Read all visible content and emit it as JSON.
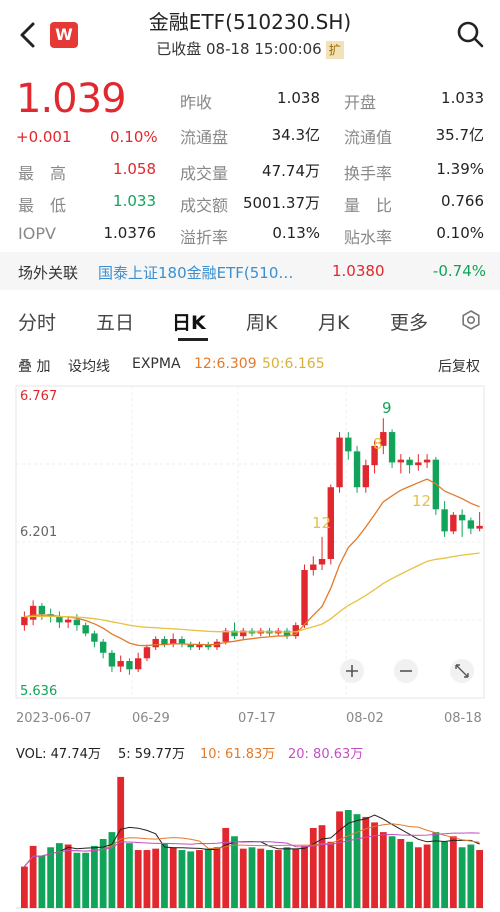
{
  "header": {
    "title": "金融ETF(510230.SH)",
    "status": "已收盘 08-18 15:00:06",
    "expand_label": "扩",
    "logo_letter": "W"
  },
  "quote": {
    "price": "1.039",
    "change": "+0.001",
    "change_pct": "0.10%",
    "left_rows": [
      {
        "label": "最　高",
        "value": "1.058",
        "color": "red"
      },
      {
        "label": "最　低",
        "value": "1.033",
        "color": "green"
      },
      {
        "label": "IOPV",
        "value": "1.0376",
        "color": "plain"
      }
    ],
    "mid_rows": [
      {
        "label": "昨收",
        "value": "1.038"
      },
      {
        "label": "流通盘",
        "value": "34.3亿"
      },
      {
        "label": "成交量",
        "value": "47.74万"
      },
      {
        "label": "成交额",
        "value": "5001.37万"
      },
      {
        "label": "溢折率",
        "value": "0.13%"
      }
    ],
    "right_rows": [
      {
        "label": "开盘",
        "value": "1.033"
      },
      {
        "label": "流通值",
        "value": "35.7亿"
      },
      {
        "label": "换手率",
        "value": "1.39%"
      },
      {
        "label": "量　比",
        "value": "0.766"
      },
      {
        "label": "贴水率",
        "value": "0.10%"
      }
    ]
  },
  "related": {
    "label": "场外关联",
    "name": "国泰上证180金融ETF(510…",
    "value": "1.0380",
    "pct": "-0.74%"
  },
  "tabs": [
    "分时",
    "五日",
    "日K",
    "周K",
    "月K",
    "更多"
  ],
  "active_tab": "日K",
  "indicators": {
    "overlay": "叠 加",
    "ma_setting": "设均线",
    "expma": "EXPMA",
    "expma12": "12:6.309",
    "expma50": "50:6.165",
    "adjust": "后复权"
  },
  "chart_data": {
    "type": "candlestick",
    "price_max_label": "6.767",
    "price_mid_label": "6.201",
    "price_min_label": "5.636",
    "x_labels": [
      "2023-06-07",
      "06-29",
      "07-17",
      "08-02",
      "08-18"
    ],
    "candle_markers": [
      "12",
      "8",
      "9",
      "12"
    ],
    "candles": [
      [
        5.9,
        5.93,
        5.95,
        5.88
      ],
      [
        5.92,
        5.97,
        5.99,
        5.9
      ],
      [
        5.97,
        5.94,
        5.98,
        5.92
      ],
      [
        5.94,
        5.93,
        5.96,
        5.91
      ],
      [
        5.93,
        5.91,
        5.95,
        5.89
      ],
      [
        5.91,
        5.92,
        5.93,
        5.89
      ],
      [
        5.92,
        5.9,
        5.94,
        5.88
      ],
      [
        5.9,
        5.87,
        5.91,
        5.86
      ],
      [
        5.87,
        5.84,
        5.88,
        5.82
      ],
      [
        5.84,
        5.8,
        5.85,
        5.78
      ],
      [
        5.8,
        5.75,
        5.81,
        5.73
      ],
      [
        5.75,
        5.77,
        5.79,
        5.73
      ],
      [
        5.77,
        5.74,
        5.78,
        5.72
      ],
      [
        5.74,
        5.78,
        5.8,
        5.73
      ],
      [
        5.78,
        5.82,
        5.83,
        5.77
      ],
      [
        5.82,
        5.85,
        5.86,
        5.81
      ],
      [
        5.85,
        5.83,
        5.86,
        5.82
      ],
      [
        5.83,
        5.85,
        5.87,
        5.82
      ],
      [
        5.85,
        5.83,
        5.86,
        5.82
      ],
      [
        5.83,
        5.82,
        5.84,
        5.81
      ],
      [
        5.82,
        5.83,
        5.84,
        5.81
      ],
      [
        5.83,
        5.82,
        5.84,
        5.81
      ],
      [
        5.82,
        5.84,
        5.85,
        5.81
      ],
      [
        5.84,
        5.88,
        5.89,
        5.83
      ],
      [
        5.88,
        5.86,
        5.91,
        5.85
      ],
      [
        5.86,
        5.88,
        5.89,
        5.85
      ],
      [
        5.88,
        5.87,
        5.89,
        5.86
      ],
      [
        5.87,
        5.88,
        5.89,
        5.86
      ],
      [
        5.88,
        5.87,
        5.89,
        5.86
      ],
      [
        5.87,
        5.88,
        5.89,
        5.86
      ],
      [
        5.88,
        5.86,
        5.89,
        5.85
      ],
      [
        5.86,
        5.9,
        5.91,
        5.85
      ],
      [
        5.9,
        6.1,
        6.12,
        5.89
      ],
      [
        6.1,
        6.12,
        6.15,
        6.08
      ],
      [
        6.12,
        6.14,
        6.22,
        6.1
      ],
      [
        6.14,
        6.4,
        6.41,
        6.12
      ],
      [
        6.4,
        6.58,
        6.6,
        6.38
      ],
      [
        6.58,
        6.53,
        6.6,
        6.5
      ],
      [
        6.53,
        6.4,
        6.55,
        6.38
      ],
      [
        6.4,
        6.48,
        6.5,
        6.38
      ],
      [
        6.48,
        6.55,
        6.57,
        6.45
      ],
      [
        6.55,
        6.6,
        6.65,
        6.52
      ],
      [
        6.6,
        6.49,
        6.61,
        6.47
      ],
      [
        6.49,
        6.5,
        6.52,
        6.45
      ],
      [
        6.5,
        6.48,
        6.51,
        6.45
      ],
      [
        6.48,
        6.49,
        6.52,
        6.46
      ],
      [
        6.49,
        6.5,
        6.52,
        6.47
      ],
      [
        6.5,
        6.32,
        6.51,
        6.3
      ],
      [
        6.32,
        6.24,
        6.35,
        6.22
      ],
      [
        6.24,
        6.3,
        6.31,
        6.23
      ],
      [
        6.3,
        6.28,
        6.32,
        6.22
      ],
      [
        6.28,
        6.25,
        6.29,
        6.23
      ],
      [
        6.25,
        6.26,
        6.31,
        6.24
      ]
    ],
    "vol_label": "VOL: 47.74万",
    "vol5_label": "5: 59.77万",
    "vol10_label": "10: 61.83万",
    "vol20_label": "20: 80.63万",
    "volumes": [
      30,
      45,
      38,
      44,
      47,
      46,
      40,
      40,
      45,
      50,
      55,
      95,
      47,
      42,
      42,
      43,
      47,
      44,
      42,
      41,
      42,
      43,
      44,
      58,
      52,
      43,
      44,
      43,
      42,
      42,
      44,
      43,
      45,
      58,
      60,
      48,
      70,
      71,
      68,
      66,
      62,
      55,
      52,
      50,
      48,
      44,
      46,
      55,
      48,
      52,
      44,
      46,
      42
    ],
    "colors": {
      "up": "#e0282e",
      "down": "#11a35a",
      "ema12": "#e37a2a",
      "ema50": "#e7c243",
      "vma10": "#e37a2a",
      "vma20": "#c44ec6",
      "vma5": "#222222"
    }
  }
}
